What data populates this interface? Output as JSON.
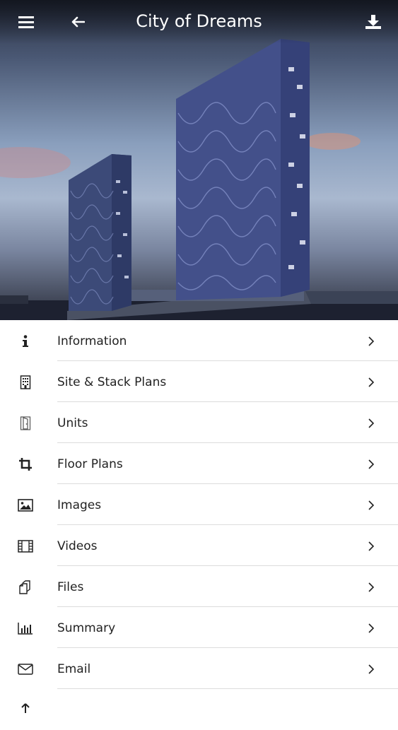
{
  "header": {
    "title": "City of Dreams",
    "menu_icon": "hamburger-menu-icon",
    "back_icon": "arrow-left-icon",
    "download_icon": "download-icon"
  },
  "hero": {
    "description_icon": "building-photo"
  },
  "menu": {
    "items": [
      {
        "label": "Information",
        "icon": "info-icon"
      },
      {
        "label": "Site & Stack Plans",
        "icon": "building-icon"
      },
      {
        "label": "Units",
        "icon": "door-icon"
      },
      {
        "label": "Floor Plans",
        "icon": "crop-icon"
      },
      {
        "label": "Images",
        "icon": "image-icon"
      },
      {
        "label": "Videos",
        "icon": "film-icon"
      },
      {
        "label": "Files",
        "icon": "files-icon"
      },
      {
        "label": "Summary",
        "icon": "bar-chart-icon"
      },
      {
        "label": "Email",
        "icon": "envelope-icon"
      }
    ]
  },
  "colors": {
    "text": "#222222",
    "separator": "#dcdcdc",
    "appbar_text": "#ffffff"
  }
}
